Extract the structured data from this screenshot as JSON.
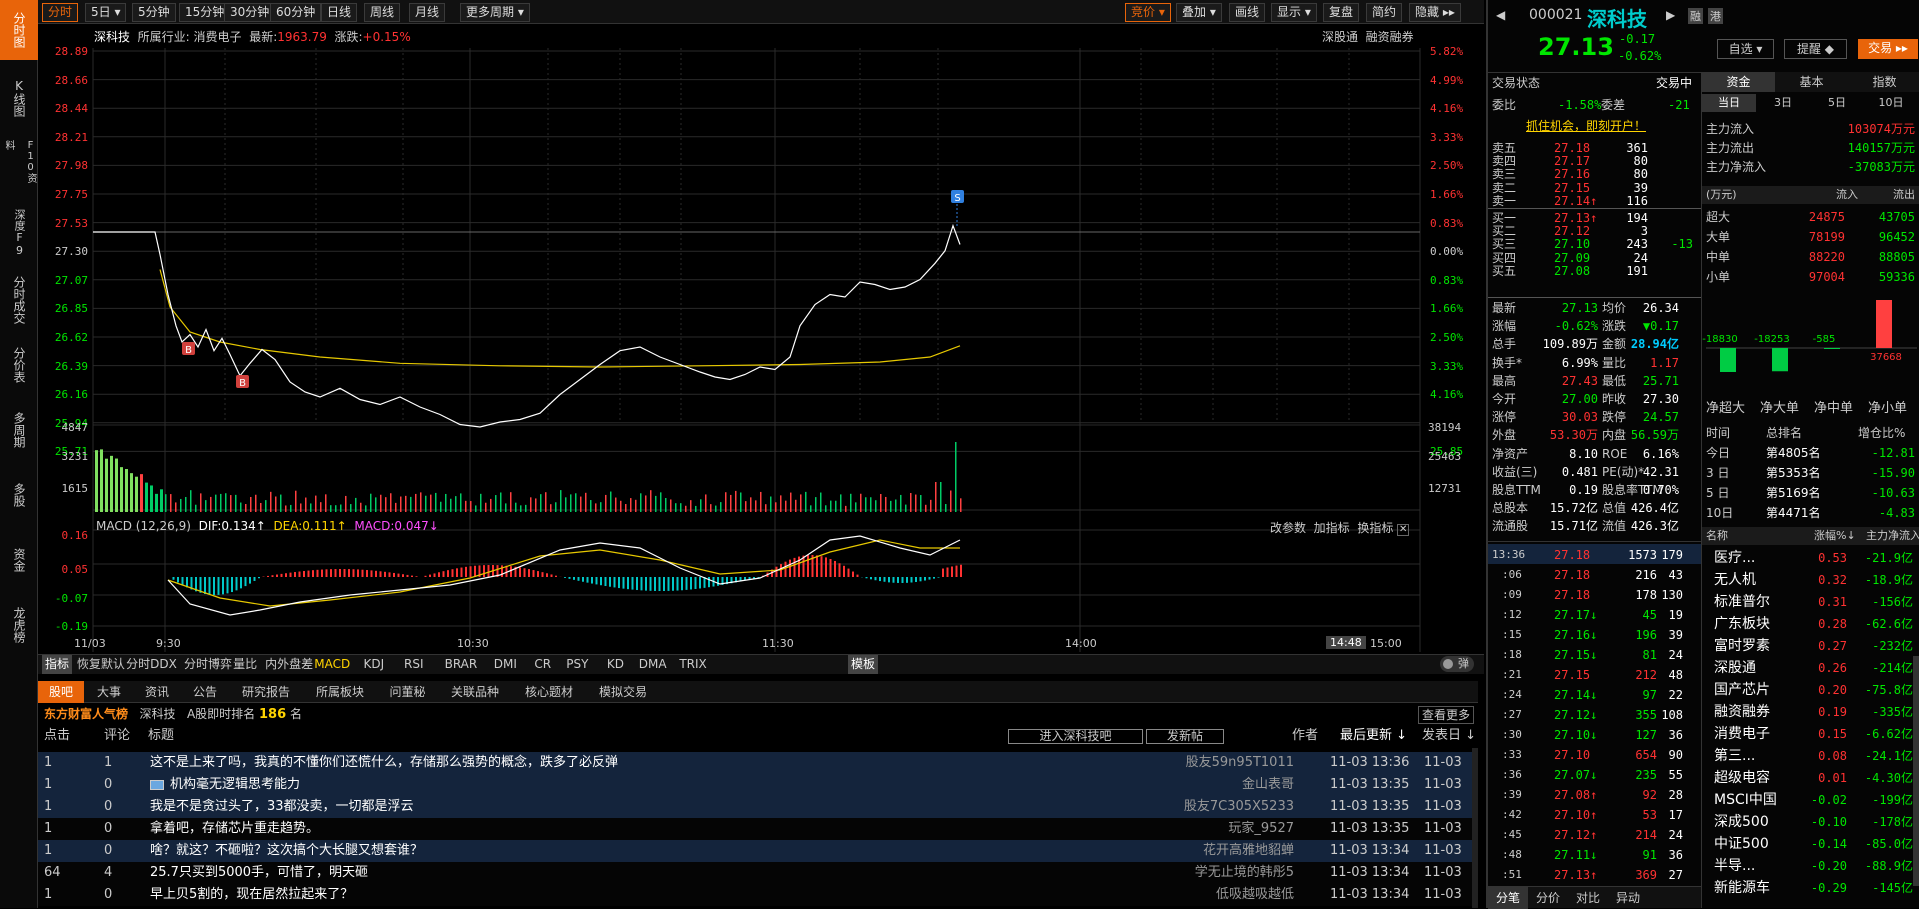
{
  "left_tabs": [
    "分时图",
    "K线图",
    "F10资料",
    "深度F9",
    "分时成交",
    "分价表",
    "多周期",
    "多股",
    "资金",
    "龙虎榜"
  ],
  "period_bar": {
    "buttons": [
      "分时",
      "5日 ▾",
      "5分钟",
      "15分钟",
      "30分钟",
      "60分钟",
      "日线",
      "周线",
      "月线",
      "更多周期 ▾"
    ],
    "right_buttons": [
      "竞价 ▾",
      "叠加 ▾",
      "画线",
      "显示 ▾",
      "复盘",
      "简约",
      "隐藏 ▸▸"
    ]
  },
  "chart_header": {
    "name": "深科技",
    "industry_label": "所属行业:",
    "industry": "消费电子",
    "latest_label": "最新:",
    "latest": "1963.79",
    "change_label": "涨跌:",
    "change": "+0.15%",
    "links": [
      "深股通",
      "融资融券"
    ]
  },
  "price_axis_left": [
    "28.89",
    "28.66",
    "28.44",
    "28.21",
    "27.98",
    "27.75",
    "27.53",
    "27.30",
    "27.07",
    "26.85",
    "26.62",
    "26.39",
    "26.16",
    "25.94",
    "25.71"
  ],
  "price_axis_right": [
    "5.82%",
    "4.99%",
    "4.16%",
    "3.33%",
    "2.50%",
    "1.66%",
    "0.83%",
    "0.00%",
    "0.83%",
    "1.66%",
    "2.50%",
    "3.33%",
    "4.16%",
    "",
    "25.85"
  ],
  "vol_axis_left": [
    "4847",
    "3231",
    "1615"
  ],
  "vol_axis_right": [
    "38194",
    "25463",
    "12731"
  ],
  "macd": {
    "label": "MACD (12,26,9)",
    "dif": "DIF:0.134↑",
    "dea": "DEA:0.111↑",
    "macd": "MACD:0.047↓",
    "links": [
      "改参数",
      "加指标",
      "换指标"
    ],
    "axis": [
      "0.16",
      "0.05",
      "-0.07",
      "-0.19"
    ]
  },
  "time_axis": [
    "11/03",
    "9:30",
    "10:30",
    "11:30",
    "14:00",
    "14:48",
    "15:00"
  ],
  "markers": [
    "B",
    "B",
    "S"
  ],
  "indicator_tabs": [
    "指标",
    "恢复默认",
    "分时DDX",
    "分时博弈",
    "量比",
    "内外盘差",
    "MACD",
    "KDJ",
    "RSI",
    "BRAR",
    "DMI",
    "CR",
    "PSY",
    "KD",
    "DMA",
    "TRIX",
    "模板"
  ],
  "popup_label": "弹",
  "forum": {
    "tabs": [
      "股吧",
      "大事",
      "资讯",
      "公告",
      "研究报告",
      "所属板块",
      "问董秘",
      "关联品种",
      "核心题材",
      "模拟交易"
    ],
    "rank_title": "东方财富人气榜",
    "rank_stock": "深科技",
    "rank_text": "A股即时排名",
    "rank_num": "186",
    "rank_unit": "名",
    "view_more": "查看更多",
    "col_headers": [
      "点击",
      "评论",
      "标题",
      "进入深科技吧",
      "发新帖",
      "作者",
      "最后更新 ↓",
      "发表日 ↓"
    ],
    "posts": [
      [
        "1",
        "1",
        "这不是上来了吗，我真的不懂你们还慌什么，存储那么强势的概念，跌多了必反弹",
        "股友59n95T1011",
        "11-03 13:36",
        "11-03"
      ],
      [
        "1",
        "0",
        "机构毫无逻辑思考能力",
        "金山表哥",
        "11-03 13:35",
        "11-03"
      ],
      [
        "1",
        "0",
        "我是不是贪过头了，33都没卖，一切都是浮云",
        "股友7C305X5233",
        "11-03 13:35",
        "11-03"
      ],
      [
        "1",
        "0",
        "拿着吧，存储芯片重走趋势。",
        "玩家_9527",
        "11-03 13:35",
        "11-03"
      ],
      [
        "1",
        "0",
        "啥？就这？不砸啦？这次搞个大长腿又想套谁？",
        "花开高雅地貂蝉",
        "11-03 13:34",
        "11-03"
      ],
      [
        "64",
        "4",
        "25.7只买到5000手，可惜了，明天砸",
        "学无止境的韩彤5",
        "11-03 13:34",
        "11-03"
      ],
      [
        "1",
        "0",
        "早上贝5割的，现在居然拉起来了？",
        "低吸越吸越低",
        "11-03 13:34",
        "11-03"
      ]
    ]
  },
  "quote": {
    "code": "000021",
    "name": "深科技",
    "price": "27.13",
    "change": "-0.17",
    "pct": "-0.62%",
    "tags": [
      "融",
      "港"
    ],
    "buttons": [
      "自选 ▾",
      "提醒 ◆",
      "交易 ▸▸"
    ],
    "status_label": "交易状态",
    "status": "交易中",
    "wb_label": "委比",
    "wb": "-1.58%",
    "wc_label": "委差",
    "wc": "-21",
    "ad": "抓住机会，即刻开户！",
    "asks": [
      [
        "卖五",
        "27.18",
        "361"
      ],
      [
        "卖四",
        "27.17",
        "80"
      ],
      [
        "卖三",
        "27.16",
        "80"
      ],
      [
        "卖二",
        "27.15",
        "39"
      ],
      [
        "卖一",
        "27.14↑",
        "116"
      ]
    ],
    "bids": [
      [
        "买一",
        "27.13↑",
        "194",
        ""
      ],
      [
        "买二",
        "27.12",
        "3",
        ""
      ],
      [
        "买三",
        "27.10",
        "243",
        "-13"
      ],
      [
        "买四",
        "27.09",
        "24",
        ""
      ],
      [
        "买五",
        "27.08",
        "191",
        ""
      ]
    ],
    "stats": [
      [
        "最新",
        "27.13",
        "均价",
        "26.34"
      ],
      [
        "涨幅",
        "-0.62%",
        "涨跌",
        "▼0.17"
      ],
      [
        "总手",
        "109.89万",
        "金额",
        "28.94亿"
      ],
      [
        "换手*",
        "6.99%",
        "量比",
        "1.17"
      ],
      [
        "最高",
        "27.43",
        "最低",
        "25.71"
      ],
      [
        "今开",
        "27.00",
        "昨收",
        "27.30"
      ],
      [
        "涨停",
        "30.03",
        "跌停",
        "24.57"
      ],
      [
        "外盘",
        "53.30万",
        "内盘",
        "56.59万"
      ],
      [
        "净资产",
        "8.10",
        "ROE",
        "6.16%"
      ],
      [
        "收益(三)",
        "0.481",
        "PE(动)*",
        "42.31"
      ],
      [
        "股息TTM",
        "0.19",
        "股息率TTM",
        "0.70%"
      ],
      [
        "总股本",
        "15.72亿",
        "总值",
        "426.4亿"
      ],
      [
        "流通股",
        "15.71亿",
        "流值",
        "426.3亿"
      ]
    ],
    "ticks": [
      [
        "13:36",
        "27.18",
        "1573",
        "179"
      ],
      [
        ":06",
        "27.18",
        "216",
        "43"
      ],
      [
        ":09",
        "27.18",
        "178",
        "130"
      ],
      [
        ":12",
        "27.17↓",
        "45",
        "19"
      ],
      [
        ":15",
        "27.16↓",
        "196",
        "39"
      ],
      [
        ":18",
        "27.15↓",
        "81",
        "24"
      ],
      [
        ":21",
        "27.15",
        "212",
        "48"
      ],
      [
        ":24",
        "27.14↓",
        "97",
        "22"
      ],
      [
        ":27",
        "27.12↓",
        "355",
        "108"
      ],
      [
        ":30",
        "27.10↓",
        "127",
        "36"
      ],
      [
        ":33",
        "27.10",
        "654",
        "90"
      ],
      [
        ":36",
        "27.07↓",
        "235",
        "55"
      ],
      [
        ":39",
        "27.08↑",
        "92",
        "28"
      ],
      [
        ":42",
        "27.10↑",
        "53",
        "17"
      ],
      [
        ":45",
        "27.12↑",
        "214",
        "24"
      ],
      [
        ":48",
        "27.11↓",
        "91",
        "36"
      ],
      [
        ":51",
        "27.13↑",
        "369",
        "27"
      ]
    ],
    "bottom_tabs": [
      "分笔",
      "分价",
      "对比",
      "异动"
    ]
  },
  "funds": {
    "tabs": [
      "资金",
      "基本",
      "指数"
    ],
    "sub_tabs": [
      "当日",
      "3日",
      "5日",
      "10日"
    ],
    "flows": [
      [
        "主力流入",
        "103074万元"
      ],
      [
        "主力流出",
        "140157万元"
      ],
      [
        "主力净流入",
        "-37083万元"
      ]
    ],
    "table_hdr": [
      "(万元)",
      "流入",
      "流出"
    ],
    "table": [
      [
        "超大",
        "24875",
        "43705"
      ],
      [
        "大单",
        "78199",
        "96452"
      ],
      [
        "中单",
        "88220",
        "88805"
      ],
      [
        "小单",
        "97004",
        "59336"
      ]
    ],
    "bar_values": [
      "-18830",
      "-18253",
      "-585",
      "37668"
    ],
    "bar_labels": [
      "净超大",
      "净大单",
      "净中单",
      "净小单"
    ],
    "rank_hdr": [
      "时间",
      "总排名",
      "增仓比%"
    ],
    "rank": [
      [
        "今日",
        "第4805名",
        "-12.81"
      ],
      [
        "3 日",
        "第5353名",
        "-15.90"
      ],
      [
        "5 日",
        "第5169名",
        "-10.63"
      ],
      [
        "10日",
        "第4471名",
        "-4.83"
      ]
    ],
    "sector_hdr": [
      "名称",
      "涨幅%↓",
      "主力净流入"
    ],
    "sectors": [
      [
        "医疗...",
        "0.53",
        "-21.9亿"
      ],
      [
        "无人机",
        "0.32",
        "-18.9亿"
      ],
      [
        "标准普尔",
        "0.31",
        "-156亿"
      ],
      [
        "广东板块",
        "0.28",
        "-62.6亿"
      ],
      [
        "富时罗素",
        "0.27",
        "-232亿"
      ],
      [
        "深股通",
        "0.26",
        "-214亿"
      ],
      [
        "国产芯片",
        "0.20",
        "-75.8亿"
      ],
      [
        "融资融券",
        "0.19",
        "-335亿"
      ],
      [
        "消费电子",
        "0.15",
        "-6.62亿"
      ],
      [
        "第三...",
        "0.08",
        "-24.1亿"
      ],
      [
        "超级电容",
        "0.01",
        "-4.30亿"
      ],
      [
        "MSCI中国",
        "-0.02",
        "-199亿"
      ],
      [
        "深成500",
        "-0.10",
        "-178亿"
      ],
      [
        "中证500",
        "-0.14",
        "-85.0亿"
      ],
      [
        "半导...",
        "-0.20",
        "-88.9亿"
      ],
      [
        "新能源车",
        "-0.29",
        "-145亿"
      ]
    ]
  }
}
